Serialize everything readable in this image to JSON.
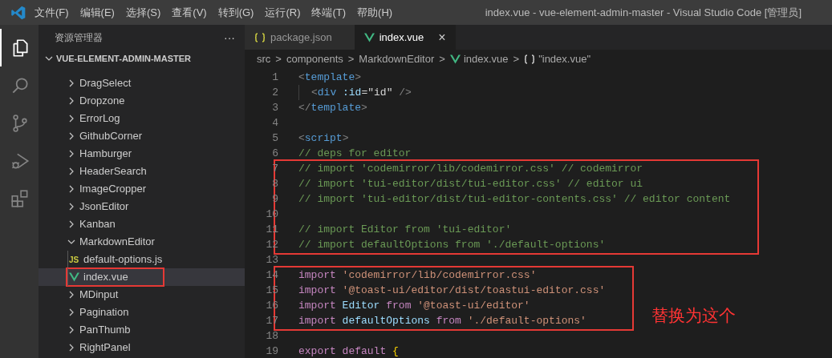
{
  "title_bar": {
    "menu": [
      "文件(F)",
      "编辑(E)",
      "选择(S)",
      "查看(V)",
      "转到(G)",
      "运行(R)",
      "终端(T)",
      "帮助(H)"
    ],
    "title": "index.vue - vue-element-admin-master - Visual Studio Code [管理员]"
  },
  "activity_bar": [
    {
      "kind": "files",
      "selected": true
    },
    {
      "kind": "search",
      "selected": false
    },
    {
      "kind": "source-control",
      "selected": false
    },
    {
      "kind": "debug",
      "selected": false
    },
    {
      "kind": "extensions",
      "selected": false
    }
  ],
  "sidebar": {
    "title": "资源管理器",
    "more": "···",
    "root": {
      "label": "VUE-ELEMENT-ADMIN-MASTER",
      "expanded": true
    },
    "tree": [
      {
        "label": "DragSelect",
        "kind": "folder",
        "expanded": false,
        "selected": false
      },
      {
        "label": "Dropzone",
        "kind": "folder",
        "expanded": false,
        "selected": false
      },
      {
        "label": "ErrorLog",
        "kind": "folder",
        "expanded": false,
        "selected": false
      },
      {
        "label": "GithubCorner",
        "kind": "folder",
        "expanded": false,
        "selected": false
      },
      {
        "label": "Hamburger",
        "kind": "folder",
        "expanded": false,
        "selected": false
      },
      {
        "label": "HeaderSearch",
        "kind": "folder",
        "expanded": false,
        "selected": false
      },
      {
        "label": "ImageCropper",
        "kind": "folder",
        "expanded": false,
        "selected": false
      },
      {
        "label": "JsonEditor",
        "kind": "folder",
        "expanded": false,
        "selected": false
      },
      {
        "label": "Kanban",
        "kind": "folder",
        "expanded": false,
        "selected": false
      },
      {
        "label": "MarkdownEditor",
        "kind": "folder",
        "expanded": true,
        "selected": false,
        "children": [
          {
            "label": "default-options.js",
            "kind": "js",
            "icon_text": "JS",
            "selected": false,
            "marked": false
          },
          {
            "label": "index.vue",
            "kind": "vue",
            "selected": true,
            "marked": true
          }
        ]
      },
      {
        "label": "MDinput",
        "kind": "folder",
        "expanded": false,
        "selected": false
      },
      {
        "label": "Pagination",
        "kind": "folder",
        "expanded": false,
        "selected": false
      },
      {
        "label": "PanThumb",
        "kind": "folder",
        "expanded": false,
        "selected": false
      },
      {
        "label": "RightPanel",
        "kind": "folder",
        "expanded": false,
        "selected": false
      }
    ]
  },
  "tabs": [
    {
      "label": "package.json",
      "kind": "json",
      "selected": false
    },
    {
      "label": "index.vue",
      "kind": "vue",
      "selected": true,
      "close": "×"
    }
  ],
  "breadcrumb": [
    {
      "label": "src",
      "kind": "folder"
    },
    {
      "label": "components",
      "kind": "folder"
    },
    {
      "label": "MarkdownEditor",
      "kind": "folder"
    },
    {
      "label": "index.vue",
      "kind": "vue"
    },
    {
      "label": "\"index.vue\"",
      "kind": "object"
    }
  ],
  "breadcrumb_separator": ">",
  "code": [
    {
      "boxed": false,
      "lines": [
        {
          "number": "1",
          "tokens": [
            {
              "kind": "punct",
              "text": "<"
            },
            {
              "kind": "tag",
              "text": "template"
            },
            {
              "kind": "punct",
              "text": ">"
            }
          ]
        },
        {
          "number": "2",
          "indent": true,
          "tokens": [
            {
              "kind": "punct",
              "text": "<"
            },
            {
              "kind": "tag",
              "text": "div"
            },
            {
              "kind": "attr",
              "text": " :id"
            },
            {
              "kind": "text",
              "text": "=\"id\""
            },
            {
              "kind": "punct",
              "text": " />"
            }
          ]
        },
        {
          "number": "3",
          "tokens": [
            {
              "kind": "punct",
              "text": "</"
            },
            {
              "kind": "tag",
              "text": "template"
            },
            {
              "kind": "punct",
              "text": ">"
            }
          ]
        },
        {
          "number": "4"
        },
        {
          "number": "5",
          "tokens": [
            {
              "kind": "punct",
              "text": "<"
            },
            {
              "kind": "tag",
              "text": "script"
            },
            {
              "kind": "punct",
              "text": ">"
            }
          ]
        },
        {
          "number": "6",
          "tokens": [
            {
              "kind": "comment",
              "text": "// deps for editor"
            }
          ]
        }
      ]
    },
    {
      "boxed": true,
      "lines": [
        {
          "number": "7",
          "tokens": [
            {
              "kind": "comment",
              "text": "// import 'codemirror/lib/codemirror.css' // codemirror"
            }
          ]
        },
        {
          "number": "8",
          "tokens": [
            {
              "kind": "comment",
              "text": "// import 'tui-editor/dist/tui-editor.css' // editor ui"
            }
          ]
        },
        {
          "number": "9",
          "tokens": [
            {
              "kind": "comment",
              "text": "// import 'tui-editor/dist/tui-editor-contents.css' // editor content"
            }
          ]
        },
        {
          "number": "10"
        },
        {
          "number": "11",
          "tokens": [
            {
              "kind": "comment",
              "text": "// import Editor from 'tui-editor'"
            }
          ]
        },
        {
          "number": "12",
          "tokens": [
            {
              "kind": "comment",
              "text": "// import defaultOptions from './default-options'"
            }
          ]
        }
      ]
    },
    {
      "boxed": false,
      "lines": [
        {
          "number": "13"
        }
      ]
    },
    {
      "boxed": true,
      "note": "替换为这个",
      "lines": [
        {
          "number": "14",
          "tokens": [
            {
              "kind": "keyword",
              "text": "import"
            },
            {
              "kind": "string",
              "text": " 'codemirror/lib/codemirror.css'"
            }
          ]
        },
        {
          "number": "15",
          "tokens": [
            {
              "kind": "keyword",
              "text": "import"
            },
            {
              "kind": "string",
              "text": " '@toast-ui/editor/dist/toastui-editor.css'"
            }
          ]
        },
        {
          "number": "16",
          "tokens": [
            {
              "kind": "keyword",
              "text": "import"
            },
            {
              "kind": "var",
              "text": " Editor"
            },
            {
              "kind": "keyword",
              "text": " from"
            },
            {
              "kind": "string",
              "text": " '@toast-ui/editor'"
            }
          ]
        },
        {
          "number": "17",
          "tokens": [
            {
              "kind": "keyword",
              "text": "import"
            },
            {
              "kind": "var",
              "text": " defaultOptions"
            },
            {
              "kind": "keyword",
              "text": " from"
            },
            {
              "kind": "string",
              "text": " './default-options'"
            }
          ]
        }
      ]
    },
    {
      "boxed": false,
      "lines": [
        {
          "number": "18"
        },
        {
          "number": "19",
          "tokens": [
            {
              "kind": "keyword",
              "text": "export"
            },
            {
              "kind": "keyword",
              "text": " default"
            },
            {
              "kind": "brace",
              "text": " {"
            }
          ]
        }
      ]
    }
  ]
}
